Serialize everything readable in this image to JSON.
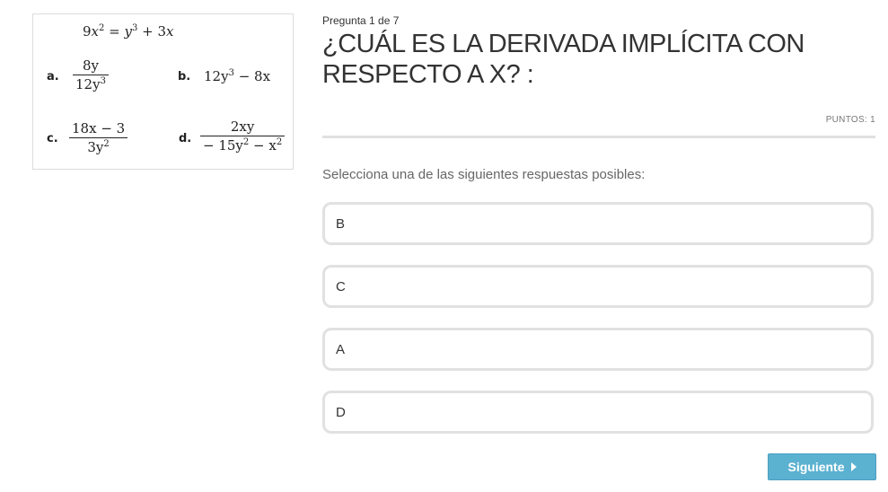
{
  "math": {
    "equation": {
      "lhs_coef": "9",
      "lhs_var": "x",
      "lhs_exp": "2",
      "eq": " = ",
      "rhs_var1": "y",
      "rhs_exp1": "3",
      "plus": " + 3",
      "rhs_var2": "x"
    },
    "options": {
      "a": {
        "letter": "a.",
        "num": "8y",
        "den_base": "12y",
        "den_exp": "3"
      },
      "b": {
        "letter": "b.",
        "base": "12y",
        "exp": "3",
        "tail": " − 8x"
      },
      "c": {
        "letter": "c.",
        "num": "18x − 3",
        "den_base": "3y",
        "den_exp": "2"
      },
      "d": {
        "letter": "d.",
        "num": "2xy",
        "den_a": "− 15y",
        "den_a_exp": "2",
        "den_b": " − x",
        "den_b_exp": "2"
      }
    }
  },
  "question": {
    "counter": "Pregunta 1 de 7",
    "title": "¿CUÁL ES LA DERIVADA IMPLÍCITA CON RESPECTO A X? :",
    "points": "PUNTOS: 1",
    "instruction": "Selecciona una de las siguientes respuestas posibles:"
  },
  "answers": [
    "B",
    "C",
    "A",
    "D"
  ],
  "navigation": {
    "next_label": "Siguiente"
  },
  "colors": {
    "button": "#5bb1d0",
    "answer_border": "#e1e1e1",
    "divider": "#e0e0e0"
  }
}
